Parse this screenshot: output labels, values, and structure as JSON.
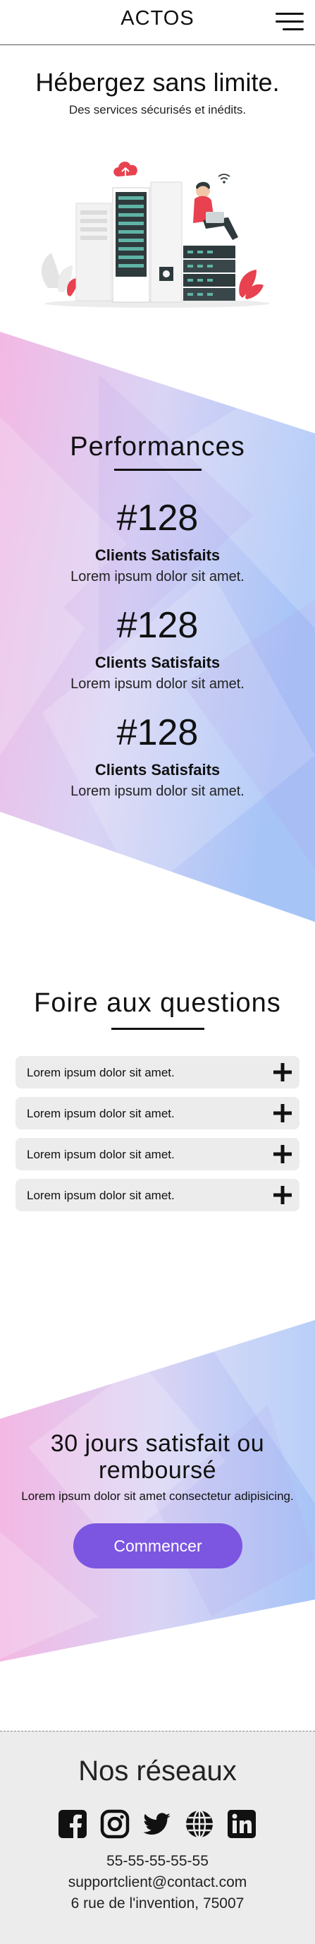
{
  "header": {
    "logo": "ACTOS",
    "menu_icon": "hamburger-menu-icon"
  },
  "hero": {
    "title": "Hébergez sans limite.",
    "subtitle": "Des services sécurisés et inédits.",
    "illustration": "server-room-illustration"
  },
  "performances": {
    "title": "Performances",
    "stats": [
      {
        "number": "#128",
        "label": "Clients Satisfaits",
        "description": "Lorem ipsum dolor sit amet."
      },
      {
        "number": "#128",
        "label": "Clients Satisfaits",
        "description": "Lorem ipsum dolor sit amet."
      },
      {
        "number": "#128",
        "label": "Clients Satisfaits",
        "description": "Lorem ipsum dolor sit amet."
      }
    ]
  },
  "faq": {
    "title": "Foire aux questions",
    "items": [
      {
        "question": "Lorem ipsum dolor sit amet."
      },
      {
        "question": "Lorem ipsum dolor sit amet."
      },
      {
        "question": "Lorem ipsum dolor sit amet."
      },
      {
        "question": "Lorem ipsum dolor sit amet."
      }
    ],
    "expand_icon": "plus-icon"
  },
  "cta": {
    "title_line1": "30 jours satisfait ou",
    "title_line2": "remboursé",
    "subtitle": "Lorem ipsum dolor sit amet consectetur adipisicing.",
    "button_label": "Commencer"
  },
  "footer": {
    "title": "Nos réseaux",
    "social_icons": [
      "facebook-icon",
      "instagram-icon",
      "twitter-icon",
      "globe-icon",
      "linkedin-icon"
    ],
    "phone": "55-55-55-55-55",
    "email": "supportclient@contact.com",
    "address": "6 rue de l'invention, 75007"
  },
  "colors": {
    "accent": "#7c56e0",
    "gradient_pink": "#f3b8e4",
    "gradient_blue": "#a7c4f7",
    "footer_bg": "#ececec",
    "illustration_red": "#e8414f"
  }
}
